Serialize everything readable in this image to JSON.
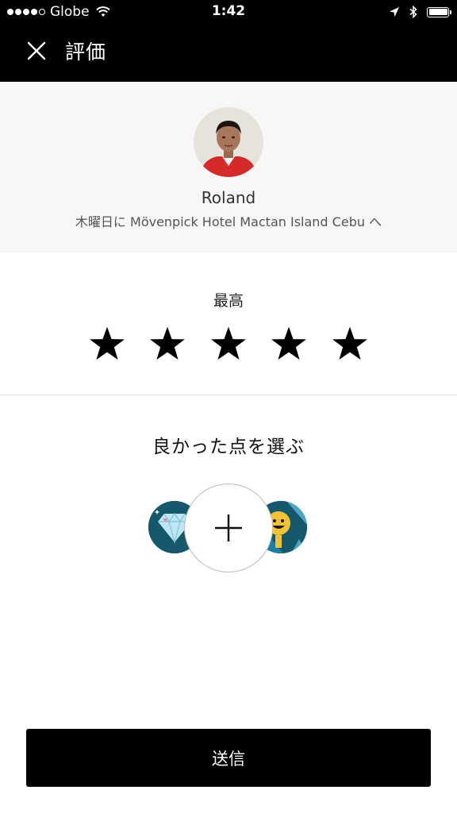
{
  "status_bar": {
    "carrier": "Globe",
    "time": "1:42",
    "signal_bars_filled": 4,
    "signal_bars_total": 5,
    "battery_level": 1.0,
    "icons": [
      "signal-icon",
      "wifi-icon",
      "location-arrow-icon",
      "bluetooth-icon",
      "battery-icon"
    ]
  },
  "header": {
    "close_icon": "close-icon",
    "title": "評価"
  },
  "driver": {
    "name": "Roland",
    "trip": "木曜日に Mövenpick Hotel Mactan Island Cebu へ"
  },
  "rating": {
    "label": "最高",
    "value": 5,
    "max": 5,
    "star_icon": "star-icon"
  },
  "compliments": {
    "title": "良かった点を選ぶ",
    "badges": [
      "diamond-badge-icon",
      "add-compliment-icon",
      "smiley-badge-icon"
    ]
  },
  "submit": {
    "label": "送信"
  },
  "colors": {
    "header_bg": "#000000",
    "driver_section_bg": "#f7f7f7",
    "badge_bg": "#16586b",
    "submit_bg": "#000000"
  }
}
